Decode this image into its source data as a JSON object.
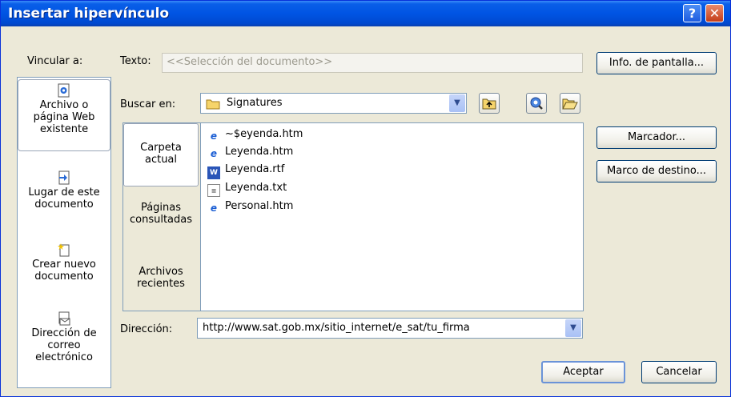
{
  "window": {
    "title": "Insertar hipervínculo",
    "help_glyph": "?",
    "close_glyph": "✕"
  },
  "link_to": {
    "label": "Vincular a:",
    "items": [
      {
        "line1": "Archivo o",
        "line2": "página Web",
        "line3": "existente",
        "icon": "web-page-file-icon"
      },
      {
        "line1": "Lugar de este",
        "line2": "documento",
        "icon": "document-place-icon"
      },
      {
        "line1": "Crear nuevo",
        "line2": "documento",
        "icon": "new-document-icon"
      },
      {
        "line1": "Dirección de",
        "line2": "correo",
        "line3": "electrónico",
        "icon": "email-icon"
      }
    ]
  },
  "text_field": {
    "label": "Texto:",
    "value": "<<Selección del documento>>"
  },
  "screen_tip_button": "Info. de pantalla...",
  "look_in": {
    "label": "Buscar en:",
    "value": "Signatures"
  },
  "browse_tabs": [
    {
      "line1": "Carpeta",
      "line2": "actual"
    },
    {
      "line1": "Páginas",
      "line2": "consultadas"
    },
    {
      "line1": "Archivos",
      "line2": "recientes"
    }
  ],
  "files": [
    {
      "name": "~$eyenda.htm",
      "icon": "ie-html-icon"
    },
    {
      "name": "Leyenda.htm",
      "icon": "ie-html-icon"
    },
    {
      "name": "Leyenda.rtf",
      "icon": "word-rtf-icon"
    },
    {
      "name": "Leyenda.txt",
      "icon": "text-file-icon"
    },
    {
      "name": "Personal.htm",
      "icon": "ie-html-icon"
    }
  ],
  "bookmark_button": "Marcador...",
  "target_frame_button": "Marco de destino...",
  "address": {
    "label": "Dirección:",
    "value": "http://www.sat.gob.mx/sitio_internet/e_sat/tu_firma"
  },
  "ok_button": "Aceptar",
  "cancel_button": "Cancelar"
}
